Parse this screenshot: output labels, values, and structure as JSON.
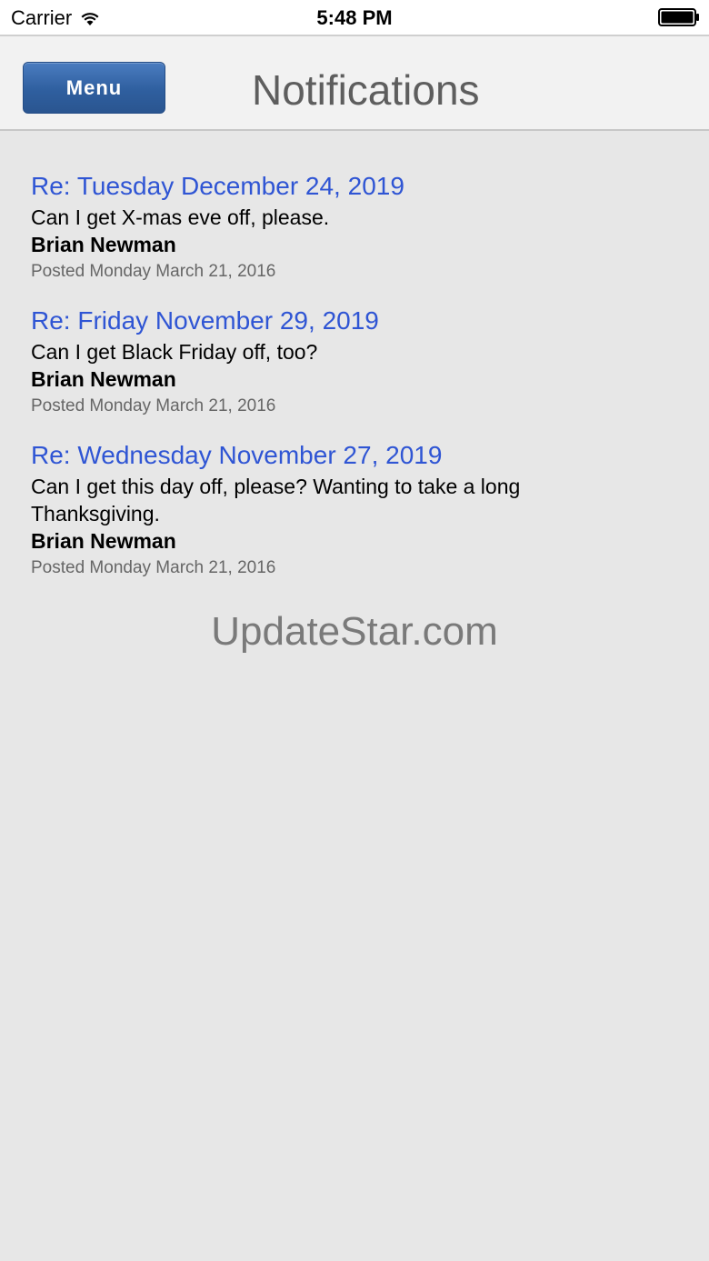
{
  "status_bar": {
    "carrier": "Carrier",
    "time": "5:48 PM"
  },
  "header": {
    "menu_label": "Menu",
    "title": "Notifications"
  },
  "notifications": [
    {
      "title": "Re: Tuesday December 24, 2019",
      "body": "Can I get X-mas eve off, please.",
      "author": "Brian Newman",
      "posted": "Posted Monday March 21, 2016"
    },
    {
      "title": "Re: Friday November 29, 2019",
      "body": "Can I get Black Friday off, too?",
      "author": "Brian Newman",
      "posted": "Posted Monday March 21, 2016"
    },
    {
      "title": "Re: Wednesday November 27, 2019",
      "body": "Can I get this day off, please? Wanting to take a long Thanksgiving.",
      "author": "Brian Newman",
      "posted": "Posted Monday March 21, 2016"
    }
  ],
  "watermark": "UpdateStar.com",
  "colors": {
    "accent_link": "#2f55d4",
    "menu_button": "#2f5f9f",
    "background": "#e7e7e7"
  }
}
